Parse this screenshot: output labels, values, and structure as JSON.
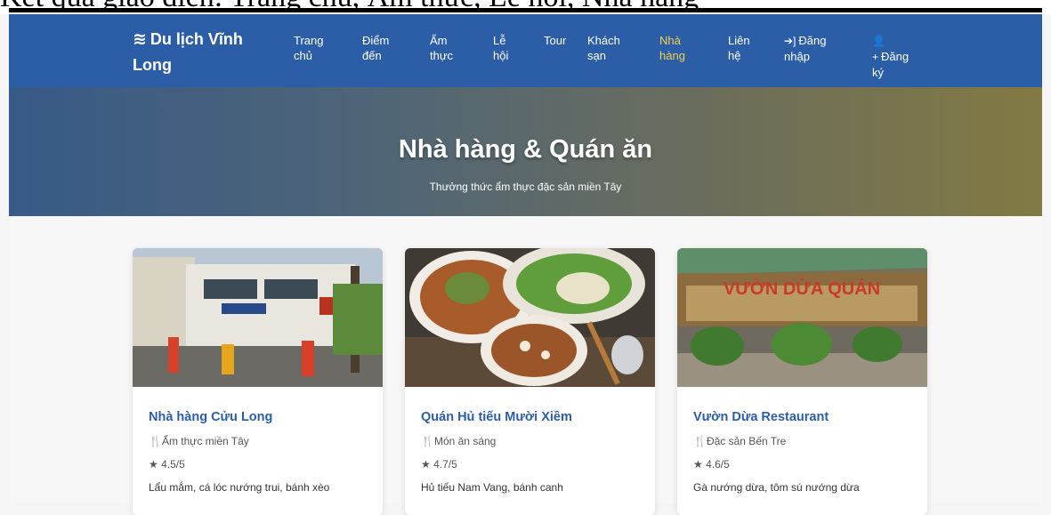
{
  "page_header_cut": "Kết quả giao diện: Trang chủ, Ẩm thực, Lễ hội, Nhà hàng",
  "brand": {
    "name": "Du lịch Vĩnh Long",
    "icon": "water-waves-icon"
  },
  "nav": {
    "items": [
      {
        "label": "Trang chủ"
      },
      {
        "label": "Điểm đến"
      },
      {
        "label": "Ẩm thực"
      },
      {
        "label": "Lễ hội"
      },
      {
        "label": "Tour"
      },
      {
        "label": "Khách sạn"
      },
      {
        "label": "Nhà hàng",
        "active": true
      },
      {
        "label": "Liên hệ"
      },
      {
        "label": "Đăng nhập",
        "icon": "sign-in-icon"
      },
      {
        "label": "Đăng ký",
        "icon": "user-plus-icon"
      }
    ]
  },
  "hero": {
    "title": "Nhà hàng & Quán ăn",
    "subtitle": "Thưởng thức ẩm thực đặc sản miền Tây"
  },
  "restaurants": [
    {
      "name": "Nhà hàng Cửu Long",
      "category": "Ẩm thực miền Tây",
      "rating": "4.5/5",
      "description": "Lẩu mắm, cá lóc nướng trui, bánh xèo"
    },
    {
      "name": "Quán Hủ tiếu Mười Xiềm",
      "category": "Món ăn sáng",
      "rating": "4.7/5",
      "description": "Hủ tiếu Nam Vang, bánh canh"
    },
    {
      "name": "Vườn Dừa Restaurant",
      "category": "Đặc sản Bến Tre",
      "rating": "4.6/5",
      "description": "Gà nướng dừa, tôm sú nướng dừa",
      "sign_text": "VƯỜN DỪA QUÁN"
    }
  ],
  "colors": {
    "navbar": "#2c5ea8",
    "active": "#f1d04b",
    "link": "#2c5ea8"
  }
}
